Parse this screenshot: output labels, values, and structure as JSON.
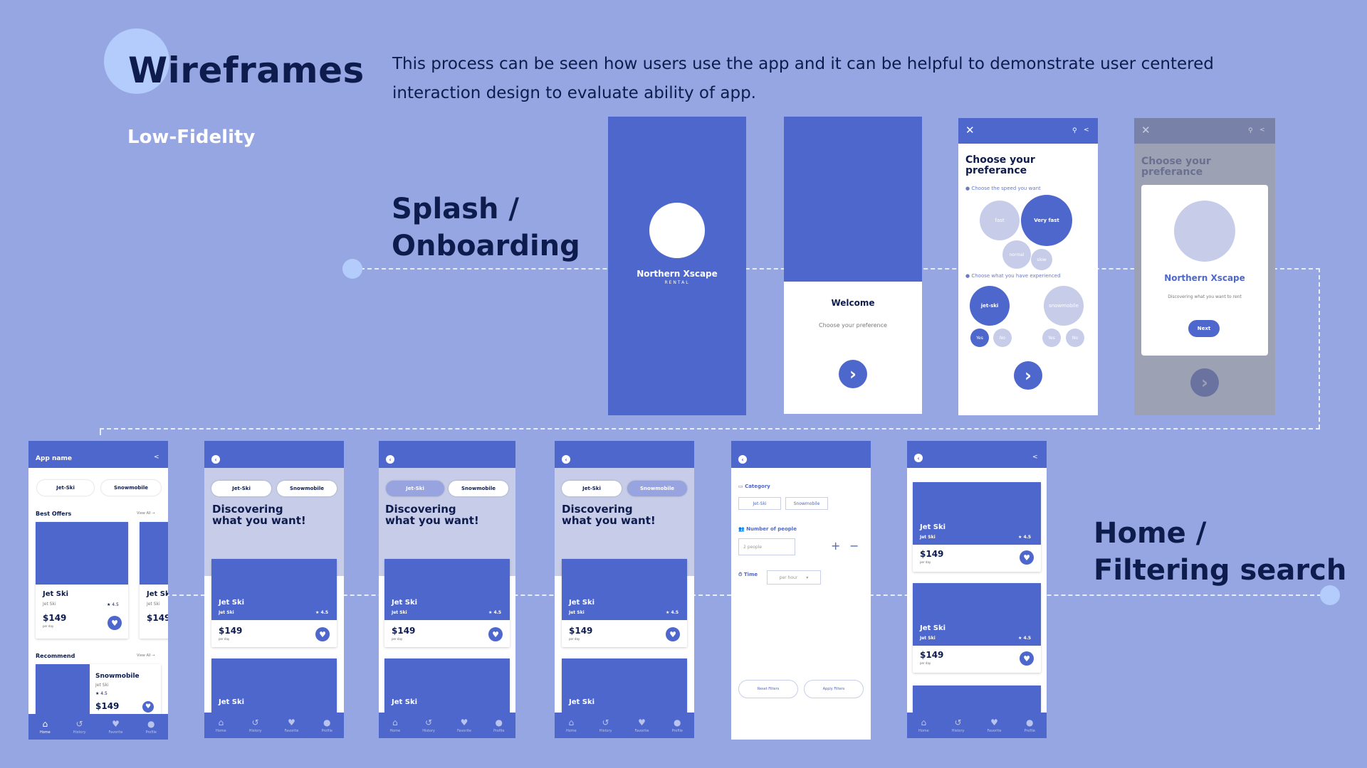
{
  "header": {
    "title": "Wireframes",
    "subtitle": "Low-Fidelity",
    "description": "This process can be seen how users use the app and it can be helpful to demonstrate user centered interaction design to evaluate ability of app."
  },
  "sections": {
    "splash_line1": "Splash /",
    "splash_line2": "Onboarding",
    "home_line1": "Home /",
    "home_line2": "Filtering search"
  },
  "splash": {
    "brand": "Northern Xscape",
    "brand_sub": "RENTAL"
  },
  "welcome": {
    "title": "Welcome",
    "subtitle": "Choose your preference"
  },
  "prefs": {
    "title_l1": "Choose your",
    "title_l2": "preferance",
    "speed_label": "Choose the speed you want",
    "speeds": [
      "fast",
      "Very fast",
      "normal",
      "slow"
    ],
    "exp_label": "Choose what you have experienced",
    "exp_items": [
      "jet-ski",
      "snowmobile"
    ],
    "yes": "Yes",
    "no": "No"
  },
  "modal": {
    "title_l1": "Choose your",
    "title_l2": "preferance",
    "brand": "Northern Xscape",
    "desc": "Discovering what you want to rent",
    "next": "Next"
  },
  "home": {
    "app_name": "App name",
    "tab1": "Jet-Ski",
    "tab2": "Snowmobile",
    "best_offers": "Best Offers",
    "view_all": "View All →",
    "recommend": "Recommend",
    "card_title": "Jet Ski",
    "card_sub": "Jet Ski",
    "rating": "★ 4.5",
    "price": "$149",
    "per_day": "per day",
    "rec_title": "Snowmobile",
    "rec_sub": "Jet Ski"
  },
  "discover": {
    "heading_l1": "Discovering",
    "heading_l2": "what you want!"
  },
  "filter": {
    "category": "Category",
    "jet_ski": "Jet-Ski",
    "snowmobile": "Snowmobile",
    "people_label": "Number of people",
    "people_value": "2 people",
    "plus": "+",
    "minus": "−",
    "time_label": "Time",
    "time_value": "per hour",
    "reset": "Reset Filters",
    "apply": "Apply Filters"
  },
  "nav": {
    "home": "Home",
    "history": "History",
    "favorite": "Favorite",
    "profile": "Profile"
  },
  "colors": {
    "background": "#96a6e2",
    "primary": "#4e67cc",
    "lavender": "#c7cde9",
    "text": "#0e1c4d"
  }
}
